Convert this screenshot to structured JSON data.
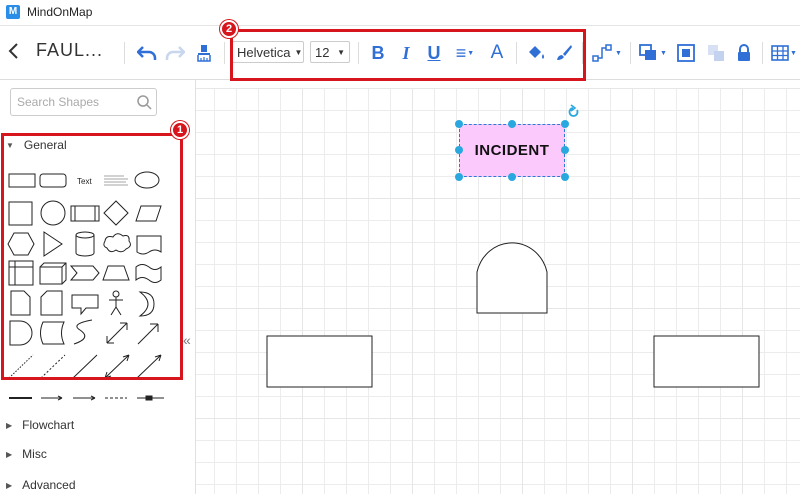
{
  "app": {
    "name": "MindOnMap",
    "logo_letter": "M"
  },
  "toolbar": {
    "doc_title": "FAUL...",
    "font_family": "Helvetica",
    "font_size": "12",
    "bold_label": "B",
    "italic_label": "I",
    "underline_label": "U",
    "align_label": "≡",
    "font_color_label": "A"
  },
  "sidebar": {
    "search_placeholder": "Search Shapes",
    "sections": [
      {
        "label": "General",
        "expanded": true
      },
      {
        "label": "Flowchart",
        "expanded": false
      },
      {
        "label": "Misc",
        "expanded": false
      },
      {
        "label": "Advanced",
        "expanded": false
      }
    ],
    "text_shape_label": "Text",
    "collapse_label": "«"
  },
  "canvas": {
    "incident_label": "INCIDENT",
    "incident_fill": "#fcc9fc"
  },
  "callouts": [
    {
      "number": "1"
    },
    {
      "number": "2"
    }
  ],
  "colors": {
    "accent": "#2f6fd6",
    "callout": "#d6161c",
    "selection": "#29a8e0"
  }
}
